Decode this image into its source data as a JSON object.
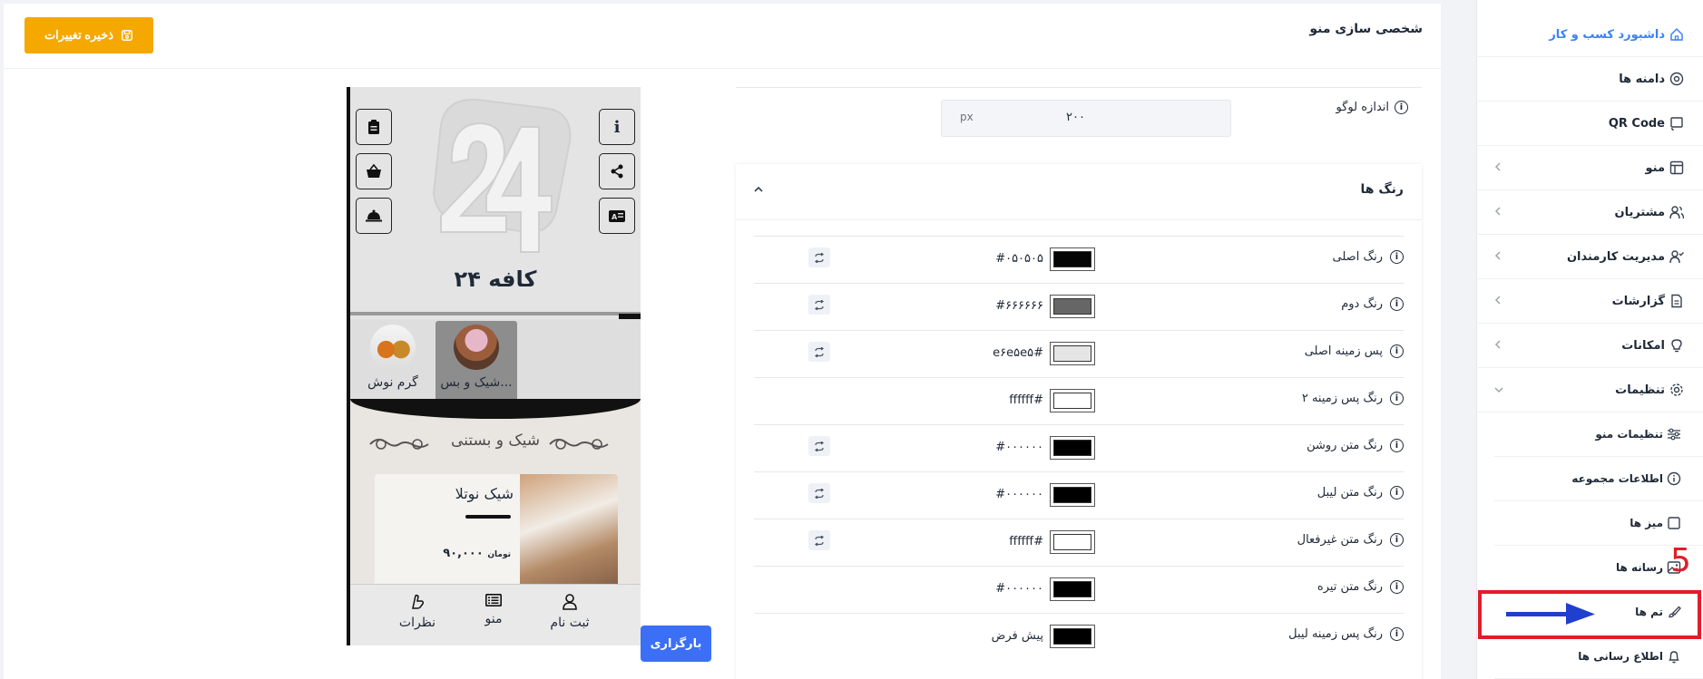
{
  "header": {
    "page_title": "شخصی سازی منو",
    "save_label": "ذخیره تغییرات"
  },
  "sidebar": {
    "items": [
      {
        "label": "داشبورد کسب و کار",
        "icon": "home-icon"
      },
      {
        "label": "دامنه ها",
        "icon": "at-icon"
      },
      {
        "label": "QR Code",
        "icon": "cast-icon"
      },
      {
        "label": "منو",
        "icon": "layout-icon"
      },
      {
        "label": "مشتریان",
        "icon": "users-icon"
      },
      {
        "label": "مدیریت کارمندان",
        "icon": "user-check-icon"
      },
      {
        "label": "گزارشات",
        "icon": "file-icon"
      },
      {
        "label": "امکانات",
        "icon": "bulb-icon"
      },
      {
        "label": "تنظیمات",
        "icon": "gear-icon"
      }
    ],
    "sub_items": [
      {
        "label": "تنظیمات منو",
        "icon": "sliders-icon"
      },
      {
        "label": "اطلاعات مجموعه",
        "icon": "info-icon"
      },
      {
        "label": "میز ها",
        "icon": "square-icon"
      },
      {
        "label": "رسانه ها",
        "icon": "image-icon"
      },
      {
        "label": "تم ها",
        "icon": "brush-icon"
      },
      {
        "label": "اطلاع رسانی ها",
        "icon": "bell-icon"
      }
    ],
    "annotation_number": "5"
  },
  "logo_size": {
    "label": "اندازه لوگو",
    "value": "۲۰۰",
    "unit": "px"
  },
  "colors": {
    "title": "رنگ ها",
    "rows": [
      {
        "label": "رنگ اصلی",
        "hex": "#۰۵۰۵۰۵",
        "color": "#050505",
        "reset": true
      },
      {
        "label": "رنگ دوم",
        "hex": "#۶۶۶۶۶۶",
        "color": "#666666",
        "reset": true
      },
      {
        "label": "پس زمینه اصلی",
        "hex": "e۶e۵e۵#",
        "color": "#e6e5e5",
        "reset": true
      },
      {
        "label": "رنگ پس زمینه ۲",
        "hex": "ffffff#",
        "color": "#ffffff",
        "reset": false
      },
      {
        "label": "رنگ متن روشن",
        "hex": "#۰۰۰۰۰۰",
        "color": "#000000",
        "reset": true
      },
      {
        "label": "رنگ متن لیبل",
        "hex": "#۰۰۰۰۰۰",
        "color": "#000000",
        "reset": true
      },
      {
        "label": "رنگ متن غیرفعال",
        "hex": "ffffff#",
        "color": "#ffffff",
        "reset": true
      },
      {
        "label": "رنگ متن تیره",
        "hex": "#۰۰۰۰۰۰",
        "color": "#000000",
        "reset": false
      },
      {
        "label": "رنگ پس زمینه لیبل",
        "hex": "پیش فرض",
        "color": "#000000",
        "reset": false
      }
    ]
  },
  "preview": {
    "cafe_name": "کافه ۲۴",
    "categories": [
      {
        "name": "شیک و بس...",
        "selected": true
      },
      {
        "name": "گرم نوش",
        "selected": false
      }
    ],
    "section_title": "شیک و بستنی",
    "product": {
      "name": "شیک نوتلا",
      "price": "۹۰,۰۰۰",
      "currency": "تومان"
    },
    "nav": [
      {
        "label": "ثبت نام",
        "icon": "user-icon"
      },
      {
        "label": "منو",
        "icon": "list-icon"
      },
      {
        "label": "نظرات",
        "icon": "comment-icon"
      }
    ],
    "upload_label": "بارگزاری"
  },
  "accent_colors": {
    "save": "#f5a800",
    "primary": "#3b6ff6",
    "highlight": "#e11d2a"
  }
}
